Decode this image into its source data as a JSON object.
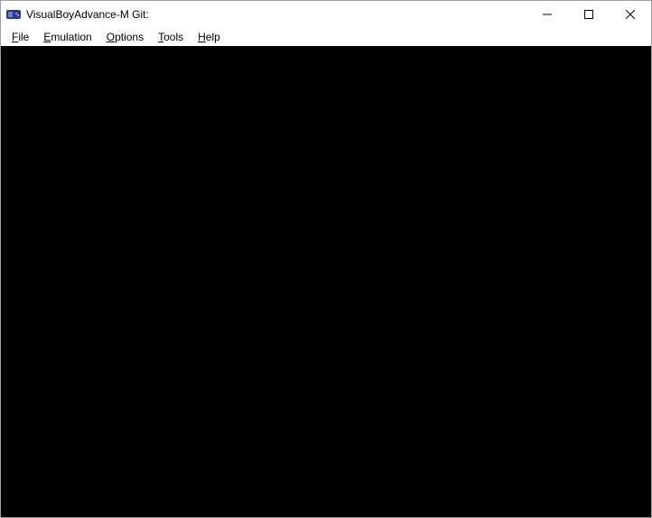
{
  "window": {
    "title": "VisualBoyAdvance-M Git:"
  },
  "menubar": {
    "items": [
      {
        "label": "File",
        "accel_index": 0
      },
      {
        "label": "Emulation",
        "accel_index": 0
      },
      {
        "label": "Options",
        "accel_index": 0
      },
      {
        "label": "Tools",
        "accel_index": 0
      },
      {
        "label": "Help",
        "accel_index": 0
      }
    ]
  }
}
